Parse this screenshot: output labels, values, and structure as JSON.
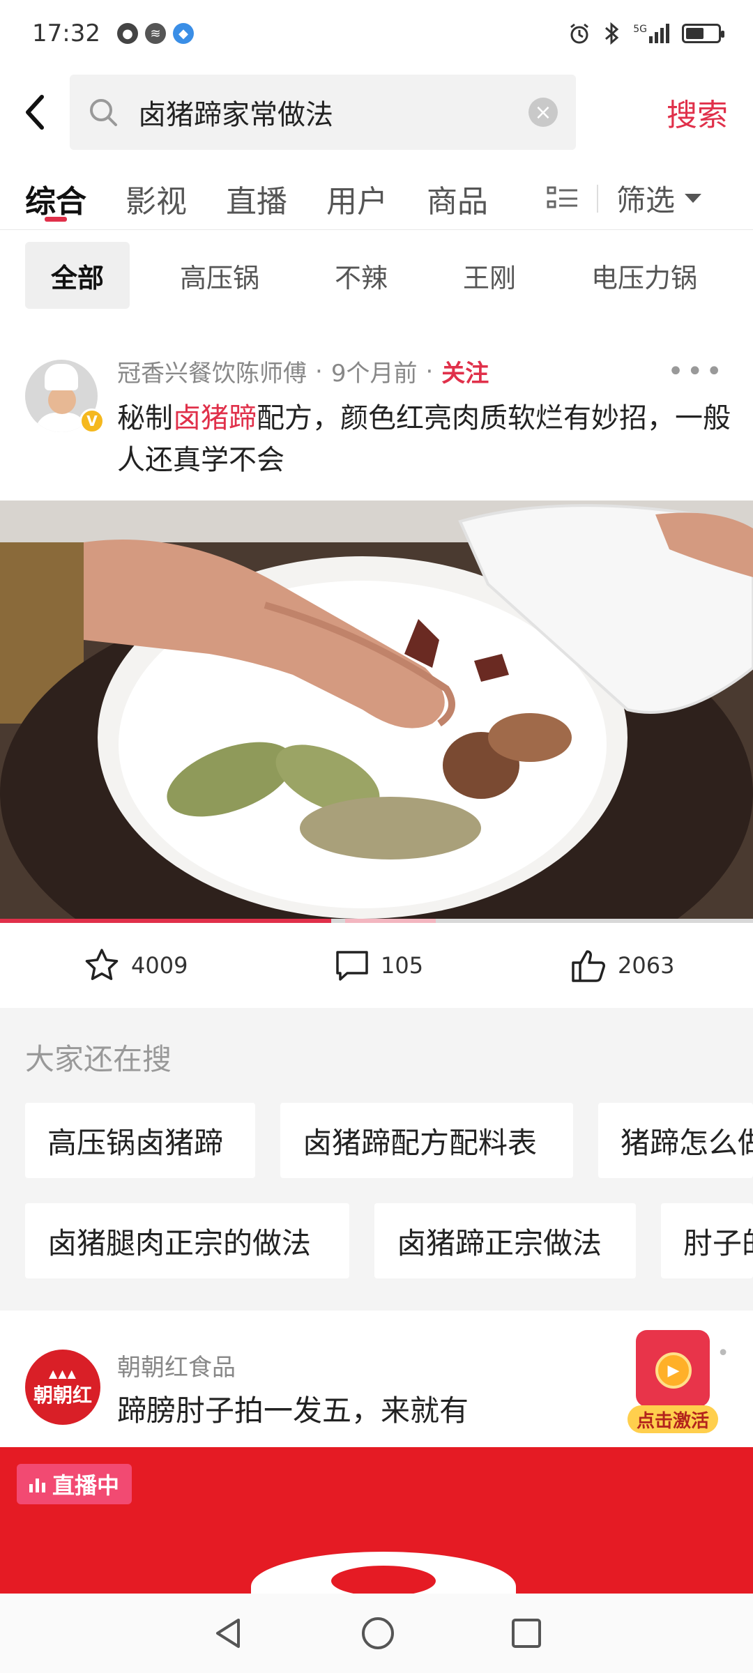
{
  "status_bar": {
    "time": "17:32",
    "network": "5G"
  },
  "search": {
    "query": "卤猪蹄家常做法",
    "search_label": "搜索"
  },
  "tabs": [
    {
      "label": "综合",
      "active": true
    },
    {
      "label": "影视"
    },
    {
      "label": "直播"
    },
    {
      "label": "用户"
    },
    {
      "label": "商品"
    }
  ],
  "filter_label": "筛选",
  "chips": [
    {
      "label": "全部",
      "active": true
    },
    {
      "label": "高压锅"
    },
    {
      "label": "不辣"
    },
    {
      "label": "王刚"
    },
    {
      "label": "电压力锅"
    }
  ],
  "post1": {
    "author": "冠香兴餐饮陈师傅",
    "sep": "·",
    "time": "9个月前",
    "follow": "关注",
    "title_prefix": "秘制",
    "title_highlight": "卤猪蹄",
    "title_suffix": "配方，颜色红亮肉质软烂有妙招，一般人还真学不会",
    "video_progress_fraction": 0.44,
    "favorites": "4009",
    "comments": "105",
    "likes": "2063"
  },
  "suggestions": {
    "heading": "大家还在搜",
    "row1": [
      "高压锅卤猪蹄",
      "卤猪蹄配方配料表",
      "猪蹄怎么做"
    ],
    "row2": [
      "卤猪腿肉正宗的做法",
      "卤猪蹄正宗做法",
      "肘子的做法"
    ]
  },
  "post2": {
    "logo_text": "朝朝红",
    "author": "朝朝红食品",
    "title": "蹄膀肘子拍一发五，来就有",
    "promo_label": "点击激活",
    "live_label": "直播中"
  },
  "colors": {
    "accent": "#e0304a",
    "live_red": "#e51b24",
    "live_badge": "#f24a72"
  }
}
